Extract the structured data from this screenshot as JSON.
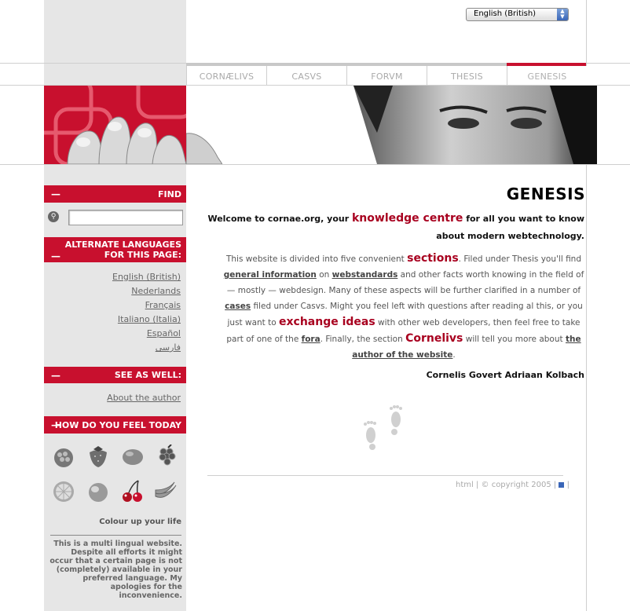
{
  "language_select": {
    "value": "English (British)"
  },
  "tabs": [
    {
      "label": "CORNÆLIVS",
      "active": false
    },
    {
      "label": "CASVS",
      "active": false
    },
    {
      "label": "FORVM",
      "active": false
    },
    {
      "label": "THESIS",
      "active": false
    },
    {
      "label": "GENESIS",
      "active": true
    }
  ],
  "sidebar": {
    "find": {
      "dash": "—",
      "label": "FIND",
      "search_value": ""
    },
    "languages": {
      "dash": "—",
      "label_line1": "ALTERNATE LANGUAGES",
      "label_line2": "FOR THIS PAGE:",
      "items": [
        "English (British)",
        "Nederlands",
        "Français",
        "Italiano (Italia)",
        "Español",
        "فارسی"
      ]
    },
    "see_as_well": {
      "dash": "—",
      "label": "SEE AS WELL:",
      "items": [
        "About the author"
      ]
    },
    "feel": {
      "dash": "—",
      "label": "HOW DO YOU FEEL TODAY",
      "fruits": [
        "raspberry-icon",
        "strawberry-icon",
        "lemon-icon",
        "grapes-icon",
        "orange-icon",
        "peach-icon",
        "cherries-icon",
        "bananas-icon"
      ],
      "caption": "Colour up your life"
    },
    "note": "This is a multi lingual website. Despite all efforts it might occur that a certain page is not (completely) available in your preferred language. My apologies for the inconvenience."
  },
  "main": {
    "title": "GENESIS",
    "intro": {
      "p1": "Welcome to cornae.org, your ",
      "big1": "knowledge centre",
      "p2": " for all you want to know",
      "p3": "about modern webtechnology."
    },
    "body": {
      "s1": "This website is divided into five convenient ",
      "sections": "sections",
      "s2": ". Filed under Thesis you'll find",
      "general_information": "general information",
      "s3": " on ",
      "webstandards": "webstandards",
      "s4": " and other facts worth knowing in the field of",
      "s5": "— mostly — webdesign. Many of these aspects will be further clarified in a number of",
      "cases": "cases",
      "s6": " filed under Casvs. Might you feel left with questions after reading al this, or you",
      "s7": "just want to ",
      "exchange_ideas": "exchange ideas",
      "s8": " with other web developers, then feel free to take",
      "s9": "part of one of the ",
      "fora": "fora",
      "s10": ". Finally, the section ",
      "cornelivs": "Cornelivs",
      "s11": " will tell you more about ",
      "the": "the",
      "author_of_the_website": "author of the website",
      "s12": "."
    },
    "signature": "Cornelis Govert Adriaan Kolbach",
    "footer": {
      "html": "html",
      "sep": " | ",
      "copyright": "© copyright 2005",
      "end": " |"
    }
  },
  "colors": {
    "accent": "#c8102e",
    "link_red": "#a8001f",
    "sidebar_bg": "#e6e6e6"
  }
}
